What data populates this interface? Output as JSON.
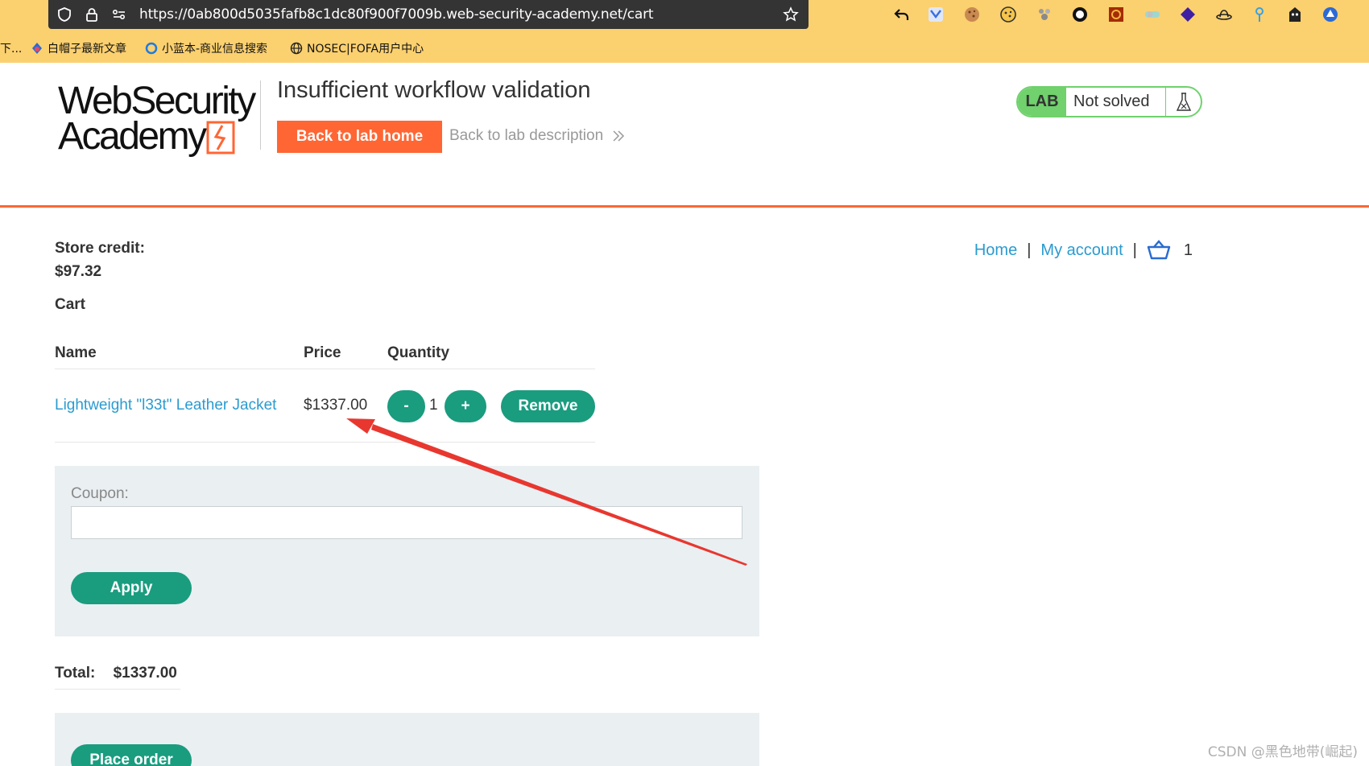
{
  "browser": {
    "url": "https://0ab800d5035fafb8c1dc80f900f7009b.web-security-academy.net/cart",
    "bookmarks": [
      {
        "label": "下..."
      },
      {
        "label": "白帽子最新文章"
      },
      {
        "label": "小蓝本-商业信息搜索"
      },
      {
        "label": "NOSEC|FOFA用户中心"
      }
    ]
  },
  "header": {
    "logo_line1": "WebSecurity",
    "logo_line2": "Academy",
    "lab_title": "Insufficient workflow validation",
    "back_home_label": "Back to lab home",
    "back_description_label": "Back to lab description",
    "lab_badge": "LAB",
    "lab_status": "Not solved"
  },
  "nav": {
    "home": "Home",
    "separator": "|",
    "my_account": "My account",
    "cart_count": "1"
  },
  "store": {
    "credit_label": "Store credit:",
    "credit_value": "$97.32",
    "cart_heading": "Cart"
  },
  "cart": {
    "columns": [
      "Name",
      "Price",
      "Quantity"
    ],
    "items": [
      {
        "name": "Lightweight \"l33t\" Leather Jacket",
        "price": "$1337.00",
        "quantity": "1",
        "decrement": "-",
        "increment": "+",
        "remove": "Remove"
      }
    ]
  },
  "coupon": {
    "label": "Coupon:",
    "value": "",
    "apply_label": "Apply"
  },
  "total": {
    "label": "Total:",
    "value": "$1337.00"
  },
  "order": {
    "place_order_label": "Place order"
  },
  "watermark": "CSDN @黑色地带(崛起)",
  "colors": {
    "browser_bar": "#fbd06f",
    "accent_orange": "#ff6633",
    "button_green": "#1a9c7f",
    "link_blue": "#2a9bd0",
    "lab_green": "#70d16d",
    "annotation_red": "#e8372f"
  }
}
